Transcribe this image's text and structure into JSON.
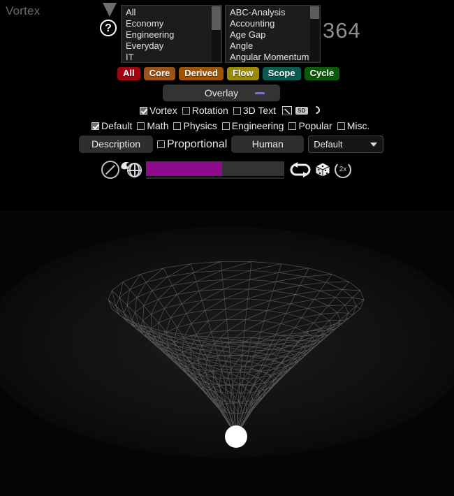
{
  "app": {
    "title": "Vortex",
    "counter": "364"
  },
  "help": {
    "icon": "question-mark-circle-icon",
    "label": "?",
    "pointer_icon": "triangle-down-icon"
  },
  "listbox_category": {
    "name": "category-list",
    "options": [
      "All",
      "Economy",
      "Engineering",
      "Everyday",
      "IT"
    ]
  },
  "listbox_topic": {
    "name": "topic-list",
    "options": [
      "ABC-Analysis",
      "Accounting",
      "Age Gap",
      "Angle",
      "Angular Momentum"
    ]
  },
  "tags": [
    {
      "label": "All",
      "color": "#a00510"
    },
    {
      "label": "Core",
      "color": "#9a5418"
    },
    {
      "label": "Derived",
      "color": "#9e5505"
    },
    {
      "label": "Flow",
      "color": "#9a8a07"
    },
    {
      "label": "Scope",
      "color": "#0a5c51"
    },
    {
      "label": "Cycle",
      "color": "#0a5c0a"
    }
  ],
  "overlay": {
    "label": "Overlay",
    "dash_color": "#7a74c8"
  },
  "view_options": [
    {
      "label": "Vortex",
      "checked": true
    },
    {
      "label": "Rotation",
      "checked": false
    },
    {
      "label": "3D Text",
      "checked": false
    }
  ],
  "view_icons": [
    {
      "name": "chart-icon",
      "label": ""
    },
    {
      "name": "sd-quality-icon",
      "label": "SD"
    },
    {
      "name": "refresh-icon",
      "label": ""
    }
  ],
  "field_options": [
    {
      "label": "Default",
      "checked": true
    },
    {
      "label": "Math",
      "checked": false
    },
    {
      "label": "Physics",
      "checked": false
    },
    {
      "label": "Engineering",
      "checked": false
    },
    {
      "label": "Popular",
      "checked": false
    },
    {
      "label": "Misc.",
      "checked": false
    }
  ],
  "description_row": {
    "description_label": "Description",
    "proportional_label": "Proportional",
    "proportional_checked": false,
    "human_label": "Human",
    "preset_selected": "Default"
  },
  "playback": {
    "block_icon": "no-entry-icon",
    "globe_icon": "globe-icon",
    "progress_percent": 55,
    "progress_color": "#8e0a8e",
    "loop_icon": "loop-icon",
    "dice_icon": "dice-icon",
    "speed_icon": "speed-2x-icon",
    "speed_label": "2x"
  },
  "viewport": {
    "name": "vortex-3d-viewport",
    "orb": "white-sphere"
  }
}
